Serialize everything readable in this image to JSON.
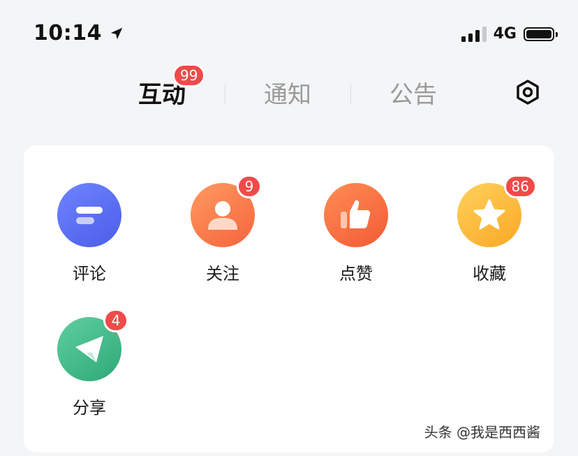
{
  "status_bar": {
    "time": "10:14",
    "network": "4G",
    "location_icon": "location-arrow-icon",
    "signal_icon": "signal-icon",
    "battery_icon": "battery-icon"
  },
  "tabs": [
    {
      "label": "互动",
      "badge": "99",
      "active": true
    },
    {
      "label": "通知",
      "active": false
    },
    {
      "label": "公告",
      "active": false
    }
  ],
  "settings_icon": "settings-hexagon-icon",
  "items": [
    {
      "label": "评论",
      "icon": "comment-icon",
      "color": "#5b6ef5"
    },
    {
      "label": "关注",
      "icon": "follow-user-icon",
      "color": "#f8703f",
      "badge": "9"
    },
    {
      "label": "点赞",
      "icon": "thumbs-up-icon",
      "color": "#f5673a"
    },
    {
      "label": "收藏",
      "icon": "star-icon",
      "color": "#fbb53a",
      "badge": "86"
    },
    {
      "label": "分享",
      "icon": "share-send-icon",
      "color": "#3bb585",
      "badge": "4"
    }
  ],
  "watermark": "头条 @我是西西酱",
  "colors": {
    "badge": "#f04a4a",
    "background": "#f4f5f7",
    "card": "#ffffff"
  }
}
